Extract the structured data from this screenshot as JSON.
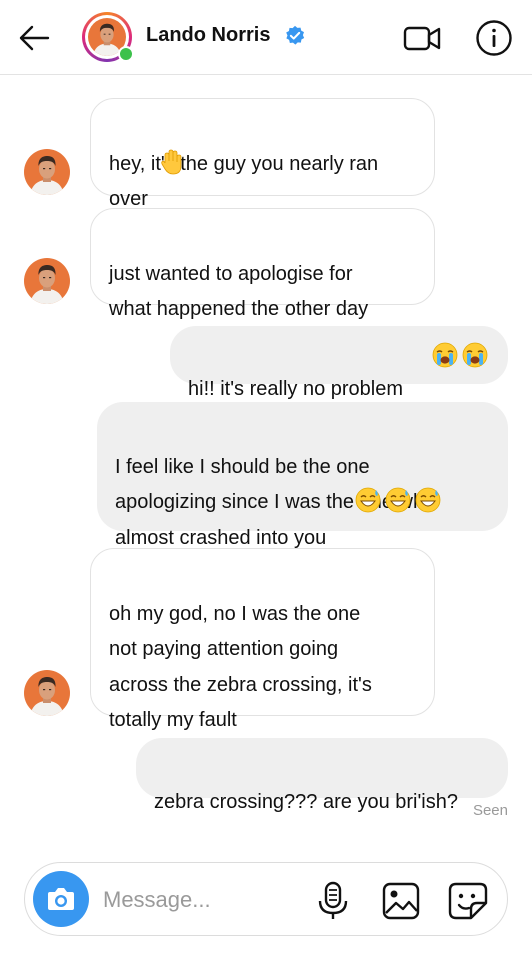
{
  "header": {
    "name": "Lando Norris",
    "icons": {
      "back": "back-arrow-icon",
      "verified": "verified-badge-icon",
      "video": "video-call-icon",
      "info": "info-icon"
    },
    "colors": {
      "verified": "#3897f0",
      "online": "#3cc14b"
    }
  },
  "messages": [
    {
      "from": "them",
      "text": "hey, it's the guy you nearly ran\nover",
      "emoji": [
        "raised-hand-emoji"
      ]
    },
    {
      "from": "them",
      "text": "just wanted to apologise for\nwhat happened the other day",
      "emoji": []
    },
    {
      "from": "me",
      "text": "hi!! it's really no problem",
      "emoji": [
        "loudly-crying-emoji",
        "loudly-crying-emoji"
      ]
    },
    {
      "from": "me",
      "text": "I feel like I should be the one\napologizing since I was the one who\nalmost crashed into you",
      "emoji": [
        "grinning-sweat-emoji",
        "grinning-sweat-emoji",
        "grinning-sweat-emoji"
      ]
    },
    {
      "from": "them",
      "text": "oh my god, no I was the one\nnot paying attention going\nacross the zebra crossing, it's\ntotally my fault",
      "emoji": []
    },
    {
      "from": "me",
      "text": "zebra crossing??? are you bri'ish?",
      "emoji": []
    }
  ],
  "status": {
    "seen": "Seen"
  },
  "composer": {
    "placeholder": "Message...",
    "icons": {
      "camera": "camera-icon",
      "mic": "microphone-icon",
      "gallery": "gallery-icon",
      "sticker": "sticker-icon"
    },
    "colors": {
      "camera_button": "#3897f0"
    }
  }
}
